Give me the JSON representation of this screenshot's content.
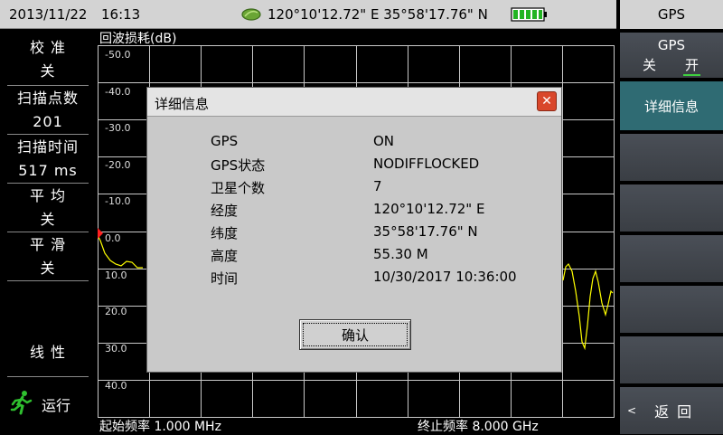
{
  "status": {
    "date": "2013/11/22",
    "time": "16:13",
    "coords": "120°10'12.72\" E 35°58'17.76\" N",
    "battery_level": 1.0,
    "sat_icon": "satellite-icon",
    "battery_icon": "battery-icon"
  },
  "panel_title": "GPS",
  "left_menu": {
    "calib": {
      "label": "校 准",
      "value": "关"
    },
    "points": {
      "label": "扫描点数",
      "value": "201"
    },
    "sweep_time": {
      "label": "扫描时间",
      "value": "517 ms"
    },
    "average": {
      "label": "平 均",
      "value": "关"
    },
    "smooth": {
      "label": "平 滑",
      "value": "关"
    },
    "scale": {
      "label": "线 性"
    },
    "run": {
      "label": "运行",
      "icon": "running-man-icon"
    }
  },
  "plot": {
    "title": "回波损耗(dB)",
    "y_ticks": [
      "-50.0",
      "-40.0",
      "-30.0",
      "-20.0",
      "-10.0",
      "0.0",
      "10.0",
      "20.0",
      "30.0",
      "40.0"
    ],
    "start_freq": "起始频率 1.000 MHz",
    "stop_freq": "终止频率 8.000 GHz",
    "grid_color": "#c8c8c8",
    "trace_color": "#ffff00",
    "marker_color": "#ff2020"
  },
  "softkeys": {
    "gps": {
      "title": "GPS",
      "off": "关",
      "on": "开"
    },
    "detail": "详细信息",
    "back": "返 回",
    "back_arrow": "<"
  },
  "dialog": {
    "title": "详细信息",
    "close_icon": "close-icon",
    "rows": [
      {
        "key": "GPS",
        "value": "ON"
      },
      {
        "key": "GPS状态",
        "value": "NODIFFLOCKED"
      },
      {
        "key": "卫星个数",
        "value": "7"
      },
      {
        "key": "经度",
        "value": "120°10'12.72\" E"
      },
      {
        "key": "纬度",
        "value": "35°58'17.76\" N"
      },
      {
        "key": "高度",
        "value": "55.30 M"
      },
      {
        "key": "时间",
        "value": "10/30/2017 10:36:00"
      }
    ],
    "ok_label": "确认"
  }
}
